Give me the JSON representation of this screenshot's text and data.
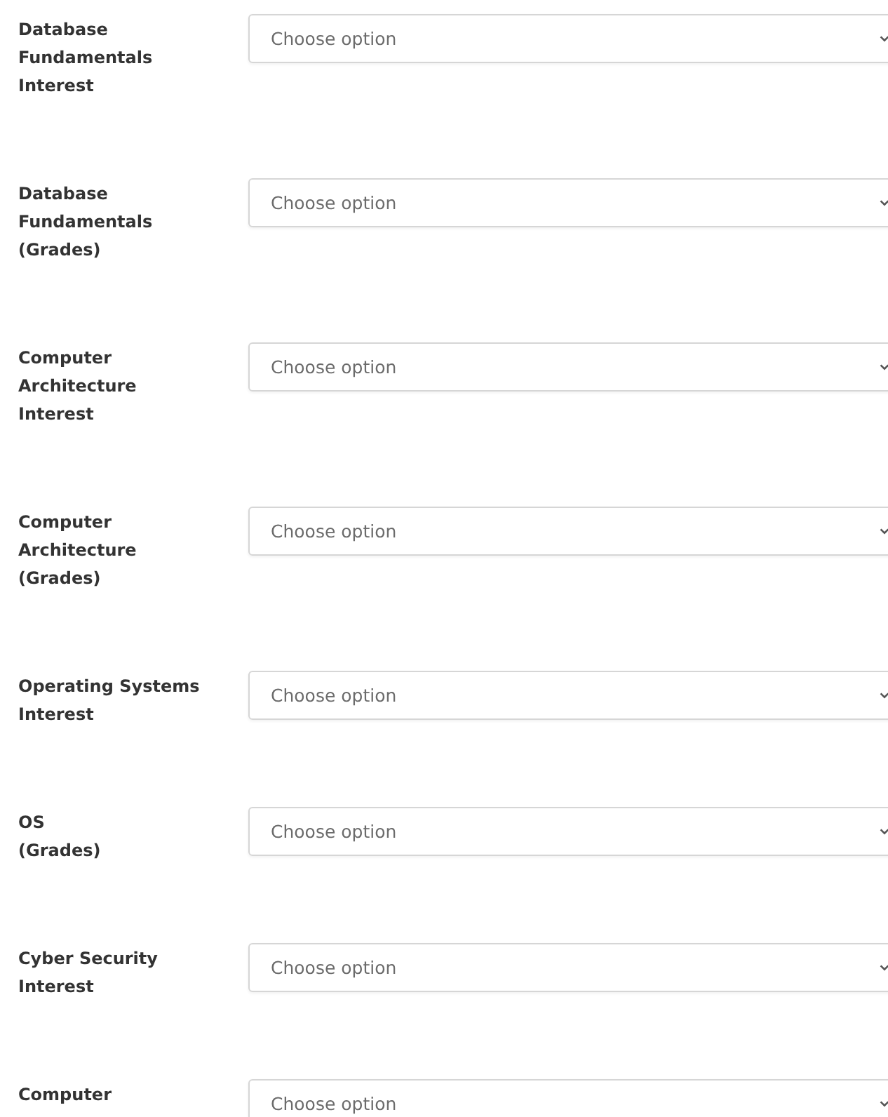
{
  "fields": [
    {
      "label": "Database\nFundamentals\nInterest",
      "placeholder": "Choose option"
    },
    {
      "label": "Database\nFundamentals\n(Grades)",
      "placeholder": "Choose option"
    },
    {
      "label": "Computer\nArchitecture\nInterest",
      "placeholder": "Choose option"
    },
    {
      "label": "Computer\nArchitecture\n(Grades)",
      "placeholder": "Choose option"
    },
    {
      "label": "Operating Systems\nInterest",
      "placeholder": "Choose option"
    },
    {
      "label": "OS\n(Grades)",
      "placeholder": "Choose option"
    },
    {
      "label": "Cyber Security\nInterest",
      "placeholder": "Choose option"
    },
    {
      "label": "Computer",
      "placeholder": "Choose option"
    }
  ]
}
